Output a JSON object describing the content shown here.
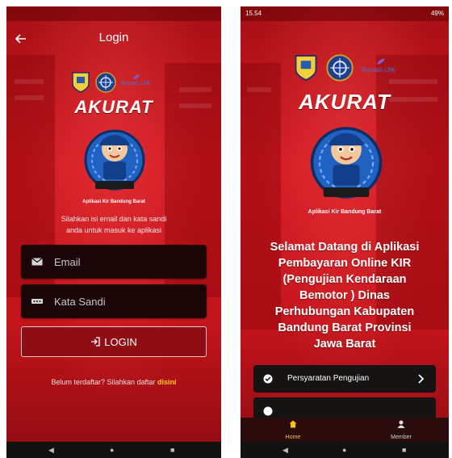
{
  "screen1": {
    "title": "Login",
    "brand": "AKURAT",
    "logo_text": "Rumah Ulik",
    "app_subtitle": "Aplikasi Kir Bandung Barat",
    "instruction_line1": "Silahkan isi email dan kata sandi",
    "instruction_line2": "anda untuk masuk ke aplikasi",
    "email_placeholder": "Email",
    "password_placeholder": "Kata Sandi",
    "login_label": "LOGIN",
    "register_text": "Belum terdaftar? Silahkan daftar",
    "register_link": "disini"
  },
  "screen2": {
    "status_time": "15.54",
    "status_battery": "49%",
    "brand": "AKURAT",
    "logo_text": "Rumah Ulik",
    "app_subtitle": "Aplikasi Kir Bandung Barat",
    "welcome_lines": [
      "Selamat Datang di Aplikasi",
      "Pembayaran Online KIR",
      "(Pengujian Kendaraan",
      "Bemotor ) Dinas",
      "Perhubungan Kabupaten",
      "Bandung Barat Provinsi",
      "Jawa Barat"
    ],
    "menu_items": [
      "Persyaratan Pengujian"
    ],
    "nav": {
      "home": "Home",
      "member": "Member"
    }
  },
  "icons": {
    "back": "arrow-left-icon",
    "email": "envelope-icon",
    "password": "password-dots-icon",
    "login": "login-icon",
    "check": "check-circle-icon",
    "chevron": "chevron-right-icon",
    "home": "home-icon",
    "member": "person-icon"
  },
  "colors": {
    "primary_red": "#c8141c",
    "dark_field": "#1b0607",
    "link_yellow": "#ffcc00",
    "home_active": "#f5c518"
  }
}
